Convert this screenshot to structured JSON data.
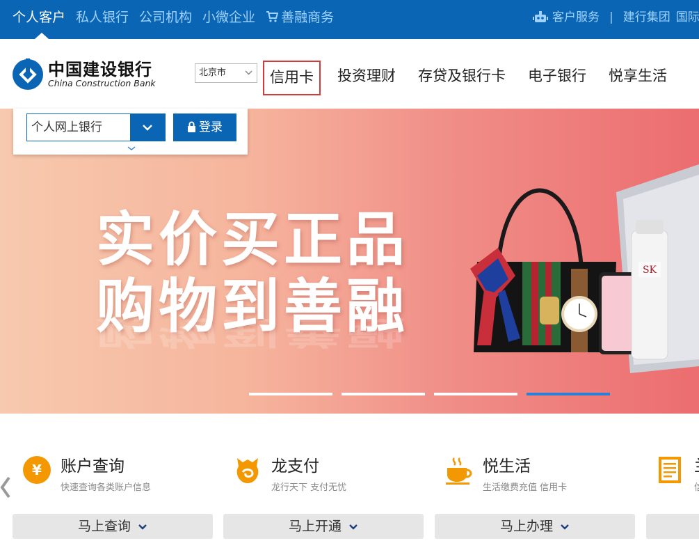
{
  "topbar": {
    "nav": [
      "个人客户",
      "私人银行",
      "公司机构",
      "小微企业",
      "善融商务"
    ],
    "right": {
      "service": "客户服务",
      "group": "建行集团",
      "intl": "国际"
    }
  },
  "header": {
    "logo_cn": "中国建设银行",
    "logo_en": "China Construction Bank",
    "city": "北京市",
    "nav": [
      "信用卡",
      "投资理财",
      "存贷及银行卡",
      "电子银行",
      "悦享生活"
    ]
  },
  "login": {
    "select_value": "个人网上银行",
    "button": "登录"
  },
  "banner": {
    "line1": "实价买正品",
    "line2": "购物到善融",
    "slides": 4,
    "active_slide": 4
  },
  "services": [
    {
      "title": "账户查询",
      "desc": "快速查询各类账户信息",
      "action": "马上查询",
      "icon": "yuan-icon"
    },
    {
      "title": "龙支付",
      "desc": "龙行天下 支付无忧",
      "action": "马上开通",
      "icon": "dragon-pay-icon"
    },
    {
      "title": "悦生活",
      "desc": "生活缴费充值 信用卡",
      "action": "马上办理",
      "icon": "coffee-cup-icon"
    },
    {
      "title": "兰",
      "desc": "信",
      "action": "",
      "icon": "document-icon"
    }
  ],
  "colors": {
    "brand_blue": "#0a65b5",
    "topnav_link": "#9fd2ff",
    "highlight_red": "#d23b3b",
    "accent_orange": "#f39800"
  }
}
